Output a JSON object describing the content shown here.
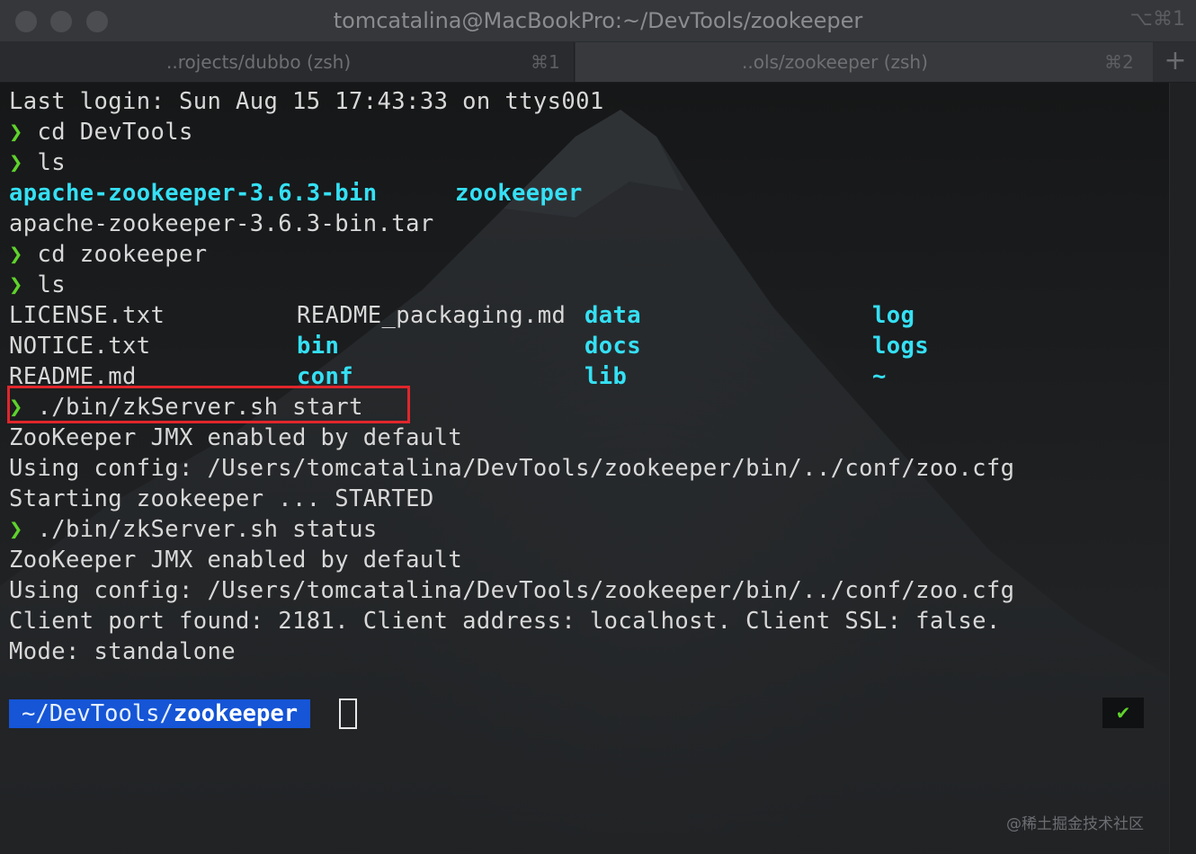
{
  "window": {
    "title": "tomcatalina@MacBookPro:~/DevTools/zookeeper",
    "title_shortcut": "⌥⌘1"
  },
  "tabs": [
    {
      "label": "..rojects/dubbo (zsh)",
      "shortcut": "⌘1",
      "active": false
    },
    {
      "label": "..ols/zookeeper (zsh)",
      "shortcut": "⌘2",
      "active": true
    }
  ],
  "new_tab_label": "+",
  "terminal": {
    "prompt_symbol": "❯",
    "lines": {
      "last_login": "Last login: Sun Aug 15 17:43:33 on ttys001",
      "cmd1": "cd DevTools",
      "cmd2": "ls",
      "ls1_a": "apache-zookeeper-3.6.3-bin",
      "ls1_b": "zookeeper",
      "ls1_c": "apache-zookeeper-3.6.3-bin.tar",
      "cmd3": "cd zookeeper",
      "cmd4": "ls",
      "ls2": [
        [
          "LICENSE.txt",
          "README_packaging.md",
          "data",
          "log"
        ],
        [
          "NOTICE.txt",
          "bin",
          "docs",
          "logs"
        ],
        [
          "README.md",
          "conf",
          "lib",
          "~"
        ]
      ],
      "cmd5": "./bin/zkServer.sh start",
      "out1": "ZooKeeper JMX enabled by default",
      "out2": "Using config: /Users/tomcatalina/DevTools/zookeeper/bin/../conf/zoo.cfg",
      "out3": "Starting zookeeper ... STARTED",
      "cmd6": "./bin/zkServer.sh status",
      "out4": "ZooKeeper JMX enabled by default",
      "out5": "Using config: /Users/tomcatalina/DevTools/zookeeper/bin/../conf/zoo.cfg",
      "out6": "Client port found: 2181. Client address: localhost. Client SSL: false.",
      "out7": "Mode: standalone"
    },
    "cwd_prefix": "~/DevTools/",
    "cwd_last": "zookeeper",
    "status_mark": "✔"
  },
  "watermark": "@稀土掘金技术社区",
  "colors": {
    "prompt": "#5fd22c",
    "directory": "#35e0f4",
    "cwd_bg": "#1555d6",
    "highlight": "#e0262c"
  }
}
